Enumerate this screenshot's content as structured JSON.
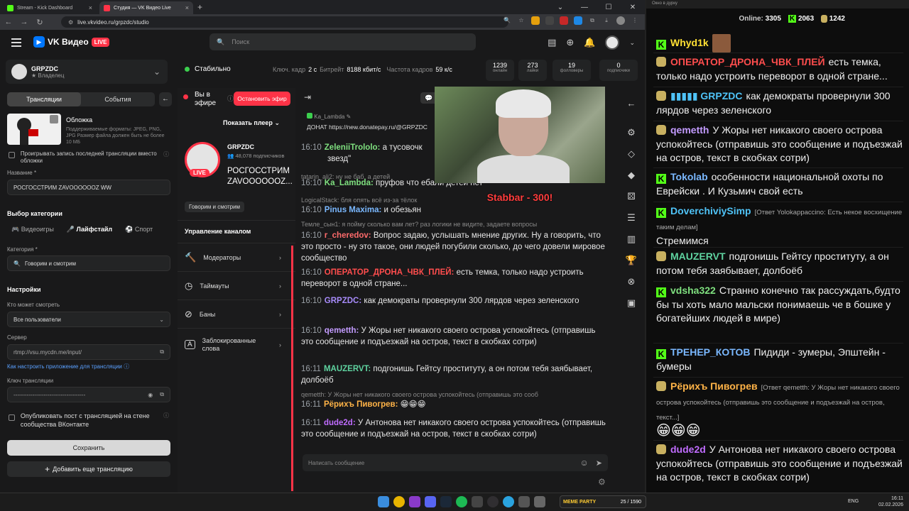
{
  "browser": {
    "tabs": [
      {
        "label": "Stream - Kick Dashboard",
        "color": "#53fc18"
      },
      {
        "label": "Студия — VK Видео Live",
        "color": "#ff3347"
      }
    ],
    "url": "live.vkvideo.ru/grpzdc/studio"
  },
  "vk": {
    "brand": "VK Видео",
    "live": "LIVE",
    "search_placeholder": "Поиск",
    "channel_name": "GRPZDC",
    "channel_role": "Владелец",
    "tabs": [
      "Трансляции",
      "События"
    ],
    "cover_title": "Обложка",
    "cover_hint": "Поддерживаемые форматы: JPEG, PNG, JPG Размер файла должен быть не более 10 МБ",
    "loop_label": "Проигрывать запись последней трансляции вместо обложки",
    "name_label": "Название *",
    "name_value": "РОСГОССТРИМ ZAVOOOOOOZ WW",
    "category_section": "Выбор категории",
    "categories": [
      "Видеоигры",
      "Лайфстайл",
      "Спорт"
    ],
    "category_label": "Категория *",
    "category_value": "Говорим и смотрим",
    "settings": "Настройки",
    "who_label": "Кто может смотреть",
    "who_value": "Все пользователи",
    "server_label": "Сервер",
    "server_value": "rtmp://vsu.mycdn.me/input/",
    "howto_link": "Как настроить приложение для трансляции",
    "key_label": "Ключ трансляции",
    "key_value": "--------------------------------------",
    "publish_label": "Опубликовать пост с трансляцией на стене сообщества ВКонтакте",
    "save": "Сохранить",
    "add": "Добавить еще трансляцию"
  },
  "status": {
    "state": "Стабильно",
    "keyframe_label": "Ключ. кадр",
    "keyframe": "2 с",
    "bitrate_label": "Битрейт",
    "bitrate": "8188 кбит/с",
    "fps_label": "Частота кадров",
    "fps": "59 к/с",
    "stats": [
      {
        "n": "1239",
        "l": "онлайн"
      },
      {
        "n": "273",
        "l": "лайки"
      },
      {
        "n": "19",
        "l": "фолловеры"
      },
      {
        "n": "0",
        "l": "подписчики"
      }
    ]
  },
  "mid": {
    "on_air": "Вы в эфире",
    "stop": "Остановить эфир",
    "show_player": "Показать плеер",
    "ch_name": "GRPZDC",
    "subs": "48,078 подписчиков",
    "title": "РОСГОССТРИМ ZAVOOOOOOZ...",
    "live": "LIVE",
    "tag": "Говорим и смотрим",
    "manage": "Управление каналом",
    "items": [
      "Модераторы",
      "Таймауты",
      "Баны",
      "Заблокированные слова"
    ]
  },
  "chat": {
    "pinned_user": "Ka_Lambda",
    "pinned_text": "ДОНАТ https://new.donatepay.ru/@GRPZDC",
    "messages": [
      {
        "t": "16:10",
        "u": "ZeleniiTrololo:",
        "c": "#7fe07f",
        "m": "а тусовочк",
        "m2": "звезд\""
      },
      {
        "dim": "tatarin_ali2: ну не баб, а детей"
      },
      {
        "t": "16:10",
        "u": "Ka_Lambda:",
        "c": "#7fe07f",
        "m": "пруфов что ебали детей нет"
      },
      {
        "dim": "LogicalStack: бля опять всё из-за тёлок"
      },
      {
        "t": "16:10",
        "u": "Pinus Maxima:",
        "c": "#7ab8ff",
        "m": "и обезьян"
      },
      {
        "dim": "Темле_сын1: я пойму сколько вам лет? раз логики не видите, задаете вопросы"
      },
      {
        "t": "16:10",
        "u": "r_cheredov:",
        "c": "#ff6b6b",
        "m": "Вопрос задаю, услышать мнение других. Ну а говорить, что это просто - ну это такое, они людей погубили сколько, до чего довели мировое сообщество"
      },
      {
        "t": "16:10",
        "u": "ОПЕРАТОР_ДРОНА_ЧВК_ПЛЕЙ:",
        "c": "#ff4d4d",
        "m": "есть темка, только надо устроить переворот в одной стране..."
      },
      {
        "t": "16:10",
        "u": "GRPZDC:",
        "c": "#a78bfa",
        "m": "как демократы провернули 300 лярдов через зеленского"
      },
      {
        "t": "16:10",
        "u": "qemetth:",
        "c": "#c39bff",
        "m": "У Жоры нет никакого своего острова успокойтесь (отправишь это сообщение и подъезжай на остров, текст в скобках сотри)"
      },
      {
        "t": "16:11",
        "u": "MAUZERVT:",
        "c": "#5fd3a0",
        "m": "подгонишь Гейтсу проституту, а он потом тебя заябывает, долбоёб"
      },
      {
        "dim": "qemetth: У Жоры нет никакого своего острова успокойтесь (отправишь это сооб"
      },
      {
        "t": "16:11",
        "u": "Рёрихъ Пивогрев:",
        "c": "#ffb347",
        "m": "😁😁😁"
      },
      {
        "t": "16:11",
        "u": "dude2d:",
        "c": "#c06cff",
        "m": "У Антонова нет никакого своего острова успокойтесь (отправишь это сообщение и подъезжай на остров, текст в скобках сотри)"
      }
    ],
    "input_placeholder": "Написать сообщение",
    "donation": "Stabbar - 300!"
  },
  "overlay": {
    "title": "Окно в дурку",
    "online_label": "Online:",
    "online": "3305",
    "kick_count": "2063",
    "vk_count": "1242",
    "messages": [
      {
        "b": "k",
        "u": "Whyd1k",
        "c": "#ffe033",
        "m": ""
      },
      {
        "b": "t",
        "u": "ОПЕРАТОР_ДРОНА_ЧВК_ПЛЕЙ",
        "c": "#ff4d4d",
        "m": "есть темка, только надо устроить переворот в одной стране..."
      },
      {
        "b": "t",
        "u": "▮▮▮▮▮ GRPZDC",
        "c": "#4fc3f7",
        "m": "как демократы провернули 300 лярдов через зеленского"
      },
      {
        "b": "t",
        "u": "qemetth",
        "c": "#c39bff",
        "m": "У Жоры нет никакого своего острова успокойтесь (отправишь это сообщение и подъезжай на остров, текст в скобках сотри)"
      },
      {
        "b": "k",
        "u": "Tokolab",
        "c": "#7ab8ff",
        "m": "особенности национальной охоты по Еврейски . И Кузьмич свой есть"
      },
      {
        "b": "k",
        "u": "DoverchiviySimp",
        "c": "#4fc3f7",
        "reply": "[Ответ Yolokappaccino: Есть некое восхищение таким делам]",
        "m": "Стремимся"
      },
      {
        "b": "t",
        "u": "MAUZERVT",
        "c": "#5fd3a0",
        "m": "подгонишь Гейтсу проституту, а он потом тебя заябывает, долбоёб"
      },
      {
        "b": "k",
        "u": "vdsha322",
        "c": "#7fe07f",
        "m": "Странно конечно так рассуждать,будто бы ты хоть мало мальски понимаешь че в бошке у богатейших людей в мире)"
      },
      {
        "b": "k",
        "u": "ТРЕНЕР_КОТОВ",
        "c": "#7ab8ff",
        "m": "Пидиди - зумеры, Эпштейн - бумеры"
      },
      {
        "b": "t",
        "u": "Рёрихъ Пивогрев",
        "c": "#ffb347",
        "reply": "[Ответ qemetth: У Жоры нет никакого своего острова успокойтесь (отправишь это сообщение и подъезжай на остров, текст...]",
        "m": "😁😁😁"
      },
      {
        "b": "t",
        "u": "dude2d",
        "c": "#c06cff",
        "m": "У Антонова нет никакого своего острова успокойтесь (отправишь это сообщение и подъезжай на остров, текст в скобках сотри)"
      }
    ]
  },
  "taskbar": {
    "lang": "ENG",
    "time": "16:11",
    "date": "02.02.2026",
    "game": "MEME PARTY",
    "game_score": "25 / 1590"
  }
}
